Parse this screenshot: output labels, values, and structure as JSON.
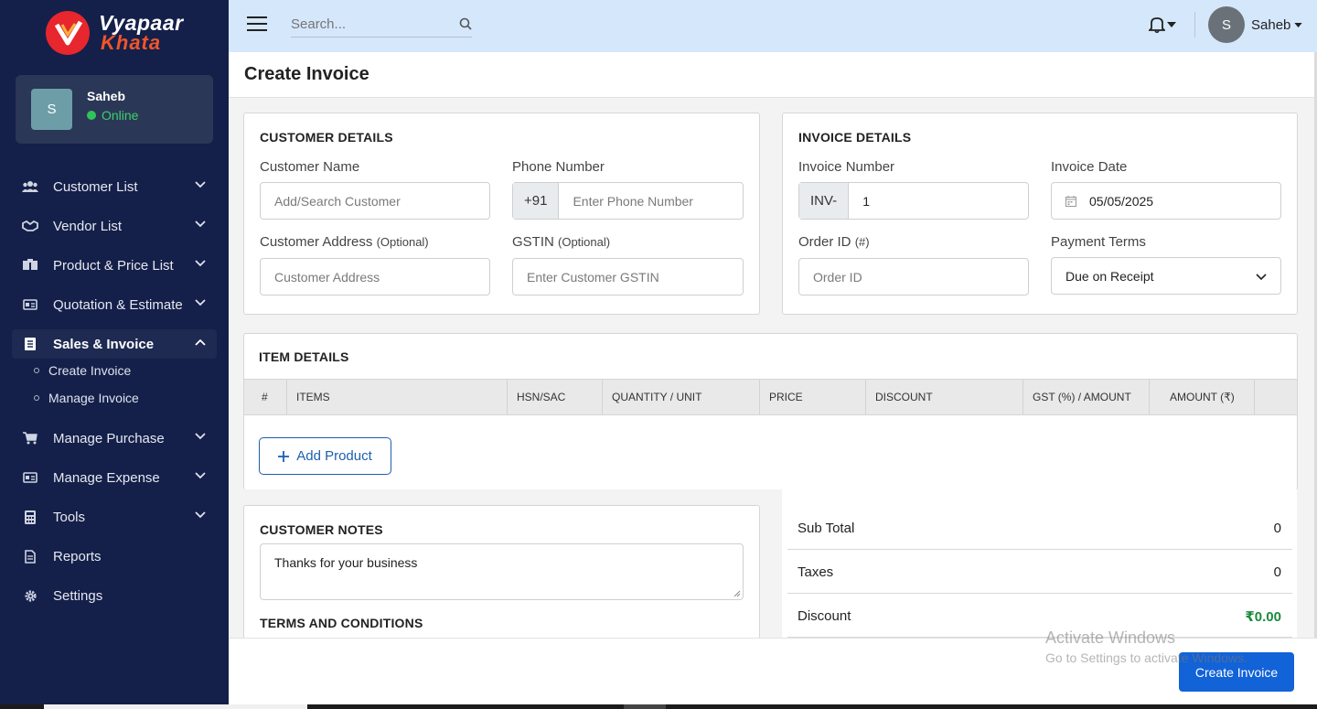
{
  "brand": {
    "line1": "Vyapaar",
    "line2": "Khata"
  },
  "user": {
    "initial": "S",
    "name": "Saheb",
    "status": "Online"
  },
  "sidebar": {
    "items": [
      {
        "label": "Customer List",
        "icon": "users-icon"
      },
      {
        "label": "Vendor List",
        "icon": "handshake-icon"
      },
      {
        "label": "Product & Price List",
        "icon": "boxes-icon"
      },
      {
        "label": "Quotation & Estimate",
        "icon": "card-icon"
      },
      {
        "label": "Sales & Invoice",
        "icon": "receipt-icon"
      },
      {
        "label": "Manage Purchase",
        "icon": "cart-icon"
      },
      {
        "label": "Manage Expense",
        "icon": "id-card-icon"
      },
      {
        "label": "Tools",
        "icon": "calculator-icon"
      },
      {
        "label": "Reports",
        "icon": "document-icon"
      },
      {
        "label": "Settings",
        "icon": "gear-icon"
      }
    ],
    "sub_items": [
      "Create Invoice",
      "Manage Invoice"
    ]
  },
  "topbar": {
    "search_placeholder": "Search...",
    "user_initial": "S",
    "user_name": "Saheb"
  },
  "page": {
    "title": "Create Invoice"
  },
  "customer": {
    "title": "CUSTOMER DETAILS",
    "name_label": "Customer Name",
    "name_placeholder": "Add/Search Customer",
    "phone_label": "Phone Number",
    "phone_prefix": "+91",
    "phone_placeholder": "Enter Phone Number",
    "address_label": "Customer Address",
    "address_opt": "(Optional)",
    "address_placeholder": "Customer Address",
    "gstin_label": "GSTIN",
    "gstin_opt": "(Optional)",
    "gstin_placeholder": "Enter Customer GSTIN"
  },
  "invoice": {
    "title": "INVOICE DETAILS",
    "number_label": "Invoice Number",
    "number_prefix": "INV-",
    "number_value": "1",
    "date_label": "Invoice Date",
    "date_value": "05/05/2025",
    "order_label": "Order ID",
    "order_hash": "(#)",
    "order_placeholder": "Order ID",
    "terms_label": "Payment Terms",
    "terms_value": "Due on Receipt"
  },
  "items": {
    "title": "ITEM DETAILS",
    "columns": [
      "#",
      "ITEMS",
      "HSN/SAC",
      "QUANTITY / UNIT",
      "PRICE",
      "DISCOUNT",
      "GST (%) / AMOUNT",
      "AMOUNT (₹)"
    ],
    "add_label": "Add Product"
  },
  "notes": {
    "title": "CUSTOMER NOTES",
    "value": "Thanks for your business",
    "terms_title": "TERMS AND CONDITIONS"
  },
  "summary": {
    "subtotal_label": "Sub Total",
    "subtotal_value": "0",
    "taxes_label": "Taxes",
    "taxes_value": "0",
    "discount_label": "Discount",
    "discount_value": "₹0.00"
  },
  "footer": {
    "create_label": "Create Invoice"
  },
  "watermark": {
    "line1": "Activate Windows",
    "line2": "Go to Settings to activate Windows."
  },
  "colors": {
    "sidebar": "#14204a",
    "topbar": "#d5e7fb",
    "primary": "#1262d8",
    "accent": "#e8262d",
    "online": "#2fc457"
  }
}
